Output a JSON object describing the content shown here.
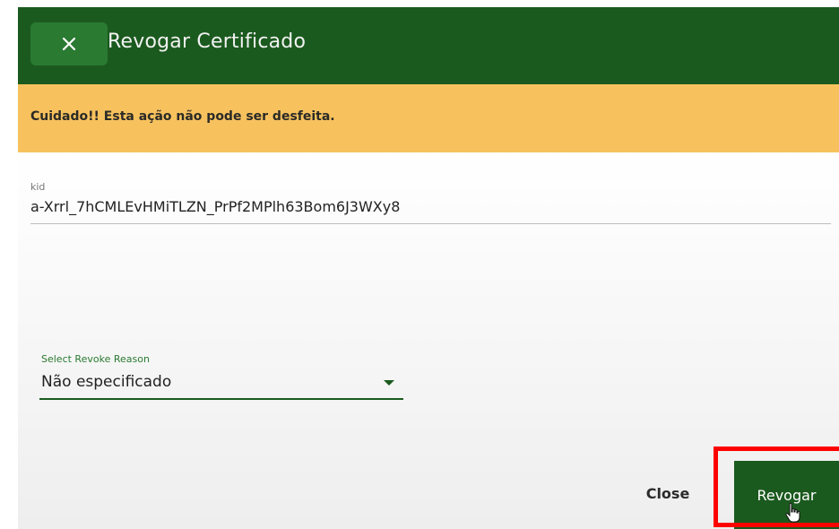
{
  "dialog": {
    "title": "Revogar Certificado",
    "close_icon": "close-icon",
    "warning": "Cuidado!! Esta ação não pode ser desfeita.",
    "kid": {
      "label": "kid",
      "value": "a-Xrrl_7hCMLEvHMiTLZN_PrPf2MPlh63Bom6J3WXy8"
    },
    "reason_select": {
      "label": "Select Revoke Reason",
      "value": "Não especificado",
      "icon": "chevron-down-icon"
    },
    "actions": {
      "close_label": "Close",
      "revoke_label": "Revogar"
    }
  },
  "colors": {
    "header": "#1b5a1e",
    "accent_green": "#2a7a32",
    "warning_bg": "#f7c25e",
    "highlight_border": "#ff0000"
  }
}
